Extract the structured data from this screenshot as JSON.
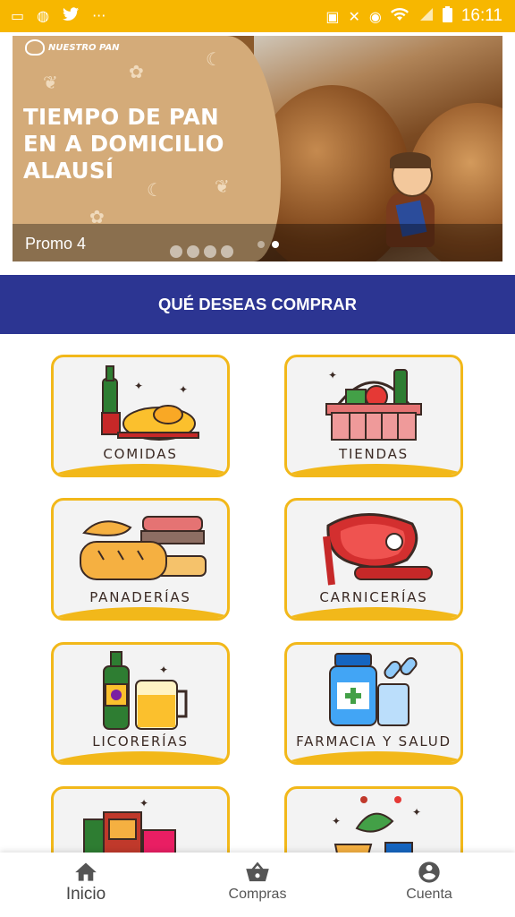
{
  "status_bar": {
    "left_icons": [
      "laptop-icon",
      "globe-icon",
      "twitter-icon",
      "more-icon"
    ],
    "right_icons": [
      "lock-icon",
      "mute-icon",
      "alarm-icon",
      "wifi-icon",
      "signal-icon",
      "battery-icon"
    ],
    "time": "16:11"
  },
  "banner": {
    "logo_text": "NUESTRO PAN",
    "title": "TIEMPO DE PAN\nEN A DOMICILIO\nALAUSÍ",
    "caption": "Promo 4",
    "dots": 2,
    "active_dot": 1
  },
  "section": {
    "title": "QUÉ DESEAS COMPRAR"
  },
  "categories": [
    {
      "label": "COMIDAS",
      "icon": "food-icon"
    },
    {
      "label": "TIENDAS",
      "icon": "grocery-basket-icon"
    },
    {
      "label": "PANADERÍAS",
      "icon": "bread-icon"
    },
    {
      "label": "CARNICERÍAS",
      "icon": "meat-icon"
    },
    {
      "label": "LICORERÍAS",
      "icon": "liquor-icon"
    },
    {
      "label": "FARMACIA Y SALUD",
      "icon": "pharmacy-icon"
    },
    {
      "label": "",
      "icon": "shopping-icon"
    },
    {
      "label": "",
      "icon": "produce-icon"
    }
  ],
  "bottom_nav": [
    {
      "label": "Inicio",
      "icon": "home-icon",
      "active": true
    },
    {
      "label": "Compras",
      "icon": "basket-icon",
      "active": false
    },
    {
      "label": "Cuenta",
      "icon": "account-icon",
      "active": false
    }
  ],
  "colors": {
    "status_bar": "#f7b700",
    "section_bar": "#2c3592",
    "card_border": "#f2b81a",
    "banner_panel": "#d4ab79"
  }
}
